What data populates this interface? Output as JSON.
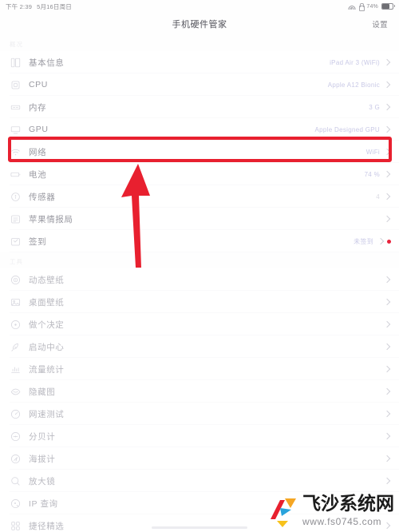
{
  "status_bar": {
    "time": "下午 2:39",
    "date": "5月16日周日",
    "wifi_icon": "wifi-icon",
    "lock_icon": "rotation-lock-icon",
    "battery_percent": "74%",
    "battery_icon": "battery-icon"
  },
  "nav": {
    "title": "手机硬件管家",
    "settings_label": "设置"
  },
  "sections": [
    {
      "header": "概况",
      "rows": [
        {
          "icon": "device-icon",
          "label": "基本信息",
          "value": "iPad Air 3 (WiFi)",
          "value_style": "blue",
          "badge": false
        },
        {
          "icon": "cpu-icon",
          "label": "CPU",
          "value": "Apple A12 Bionic",
          "value_style": "blue",
          "badge": false
        },
        {
          "icon": "memory-icon",
          "label": "内存",
          "value": "3 G",
          "value_style": "blue",
          "badge": false
        },
        {
          "icon": "gpu-icon",
          "label": "GPU",
          "value": "Apple Designed GPU",
          "value_style": "blue",
          "badge": false
        },
        {
          "icon": "wifi-icon",
          "label": "网络",
          "value": "WiFi",
          "value_style": "blue",
          "badge": false,
          "highlighted": true
        },
        {
          "icon": "battery-icon",
          "label": "电池",
          "value": "74 %",
          "value_style": "blue",
          "badge": false
        },
        {
          "icon": "sensor-icon",
          "label": "传感器",
          "value": "4",
          "value_style": "plain",
          "badge": false
        },
        {
          "icon": "news-icon",
          "label": "苹果情报局",
          "value": "",
          "value_style": "plain",
          "badge": false
        },
        {
          "icon": "checkin-icon",
          "label": "签到",
          "value": "未签到",
          "value_style": "blue",
          "badge": true
        }
      ]
    },
    {
      "header": "工具",
      "rows": [
        {
          "icon": "live-wallpaper-icon",
          "label": "动态壁纸",
          "value": "",
          "value_style": "plain",
          "badge": false
        },
        {
          "icon": "wallpaper-icon",
          "label": "桌面壁纸",
          "value": "",
          "value_style": "plain",
          "badge": false
        },
        {
          "icon": "decide-icon",
          "label": "做个决定",
          "value": "",
          "value_style": "plain",
          "badge": false
        },
        {
          "icon": "rocket-icon",
          "label": "启动中心",
          "value": "",
          "value_style": "plain",
          "badge": false
        },
        {
          "icon": "chart-icon",
          "label": "流量统计",
          "value": "",
          "value_style": "plain",
          "badge": false
        },
        {
          "icon": "hidden-image-icon",
          "label": "隐藏图",
          "value": "",
          "value_style": "plain",
          "badge": false
        },
        {
          "icon": "speedtest-icon",
          "label": "网速测试",
          "value": "",
          "value_style": "plain",
          "badge": false
        },
        {
          "icon": "decibel-icon",
          "label": "分贝计",
          "value": "",
          "value_style": "plain",
          "badge": false
        },
        {
          "icon": "altimeter-icon",
          "label": "海拔计",
          "value": "",
          "value_style": "plain",
          "badge": false
        },
        {
          "icon": "magnifier-icon",
          "label": "放大镜",
          "value": "",
          "value_style": "plain",
          "badge": false
        },
        {
          "icon": "ip-lookup-icon",
          "label": "IP 查询",
          "value": "",
          "value_style": "plain",
          "badge": false
        },
        {
          "icon": "shortcuts-icon",
          "label": "捷径精选",
          "value": "",
          "value_style": "plain",
          "badge": false
        }
      ]
    }
  ],
  "annotations": {
    "highlight_color": "#e8202f",
    "arrow_color": "#e8202f",
    "arrow_points_to": "网络"
  },
  "watermark": {
    "name": "飞沙系统网",
    "url": "www.fs0745.com",
    "logo_icon": "fs-logo-icon"
  }
}
